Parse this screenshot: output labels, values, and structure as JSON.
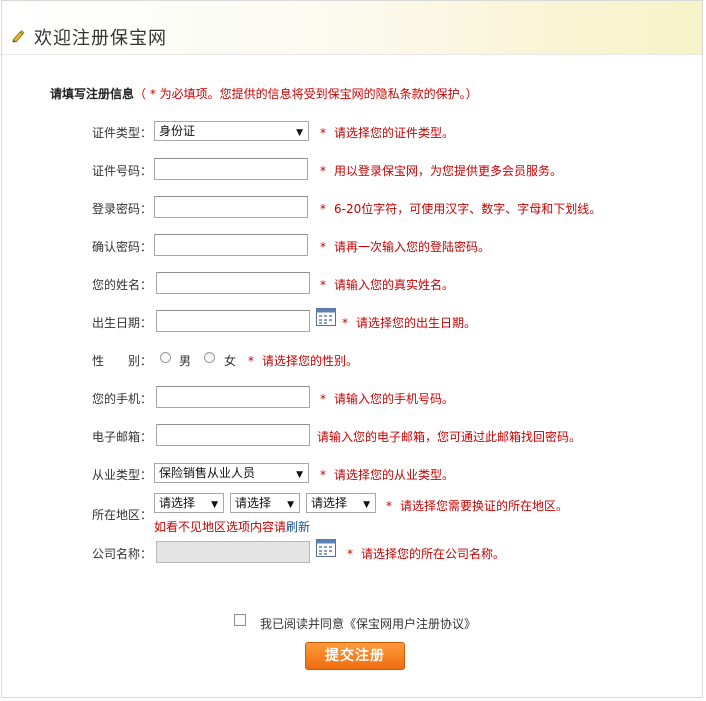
{
  "header": {
    "title": "欢迎注册保宝网"
  },
  "intro": {
    "heading": "请填写注册信息",
    "note": "（ * 为必填项。您提供的信息将受到保宝网的隐私条款的保护。）"
  },
  "form": {
    "id_type": {
      "label": "证件类型：",
      "value": "身份证",
      "hint": "请选择您的证件类型。"
    },
    "id_number": {
      "label": "证件号码：",
      "value": "",
      "hint": "用以登录保宝网，为您提供更多会员服务。"
    },
    "password": {
      "label": "登录密码：",
      "value": "",
      "hint": "6-20位字符，可使用汉字、数字、字母和下划线。"
    },
    "confirm_password": {
      "label": "确认密码：",
      "value": "",
      "hint": "请再一次输入您的登陆密码。"
    },
    "name": {
      "label": "您的姓名：",
      "value": "",
      "hint": "请输入您的真实姓名。"
    },
    "birthday": {
      "label": "出生日期：",
      "value": "",
      "hint": "请选择您的出生日期。"
    },
    "gender": {
      "label": "性　　别：",
      "male": "男",
      "female": "女",
      "hint": "请选择您的性别。"
    },
    "mobile": {
      "label": "您的手机：",
      "value": "",
      "hint": "请输入您的手机号码。"
    },
    "email": {
      "label": "电子邮箱：",
      "value": "",
      "hint": "请输入您的电子邮箱，您可通过此邮箱找回密码。"
    },
    "occupation": {
      "label": "从业类型：",
      "value": "保险销售从业人员",
      "hint": "请选择您的从业类型。"
    },
    "region": {
      "label": "所在地区：",
      "province": "请选择",
      "city": "请选择",
      "district": "请选择",
      "hint": "请选择您需要换证的所在地区。",
      "missing_text": "如看不见地区选项内容请",
      "refresh_link": "刷新"
    },
    "company": {
      "label": "公司名称：",
      "value": "",
      "hint": "请选择您的所在公司名称。"
    },
    "required_mark": "*"
  },
  "agreement": {
    "text": "我已阅读并同意《保宝网用户注册协议》",
    "checked": false
  },
  "submit": {
    "label": "提交注册"
  },
  "colors": {
    "hint_red": "#cc0000",
    "button_orange": "#f07a1c",
    "link_blue": "#1a4f8f"
  }
}
